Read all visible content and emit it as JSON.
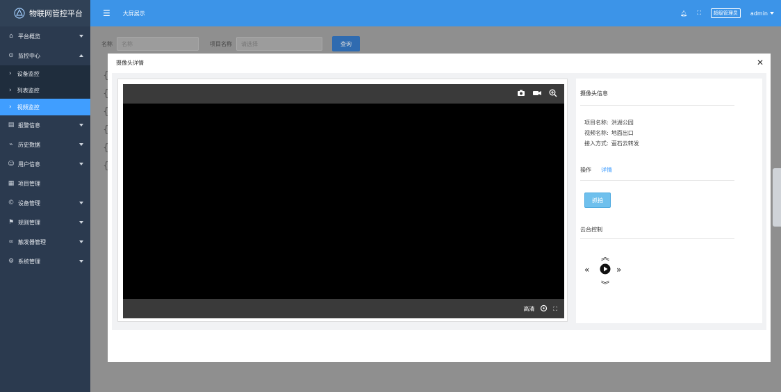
{
  "app": {
    "title": "物联网管控平台"
  },
  "sidebar": {
    "items": [
      {
        "label": "平台概览",
        "icon": "home-icon"
      },
      {
        "label": "监控中心",
        "icon": "monitor-icon"
      },
      {
        "label": "报警信息",
        "icon": "alarm-icon"
      },
      {
        "label": "历史数据",
        "icon": "chart-icon"
      },
      {
        "label": "用户信息",
        "icon": "user-icon"
      },
      {
        "label": "项目管理",
        "icon": "project-icon"
      },
      {
        "label": "设备管理",
        "icon": "device-icon"
      },
      {
        "label": "规则管理",
        "icon": "rule-icon"
      },
      {
        "label": "触发器管理",
        "icon": "trigger-icon"
      },
      {
        "label": "系统管理",
        "icon": "settings-icon"
      }
    ],
    "submenu": [
      {
        "label": "设备监控"
      },
      {
        "label": "列表监控"
      },
      {
        "label": "视频监控"
      }
    ]
  },
  "topbar": {
    "bigscreen_label": "大屏展示",
    "role_badge": "超级管理员",
    "user": "admin"
  },
  "filter": {
    "name_label": "名称",
    "name_placeholder": "名称",
    "project_label": "项目名称",
    "project_placeholder": "请选择",
    "query_label": "查询"
  },
  "modal": {
    "title": "摄像头详情",
    "video": {
      "quality_label": "高清"
    },
    "info": {
      "section_title": "摄像头信息",
      "project_name_label": "项目名称:",
      "project_name": "洪湖公园",
      "video_name_label": "视频名称:",
      "video_name": "地面出口",
      "access_label": "接入方式:",
      "access": "萤石云转发"
    },
    "ops": {
      "title": "操作",
      "detail": "详情"
    },
    "snapshot_label": "抓拍",
    "ptz_title": "云台控制"
  },
  "colors": {
    "topbar": "#3c94e8",
    "sidebar": "#2b3a4f",
    "active": "#409eff"
  }
}
